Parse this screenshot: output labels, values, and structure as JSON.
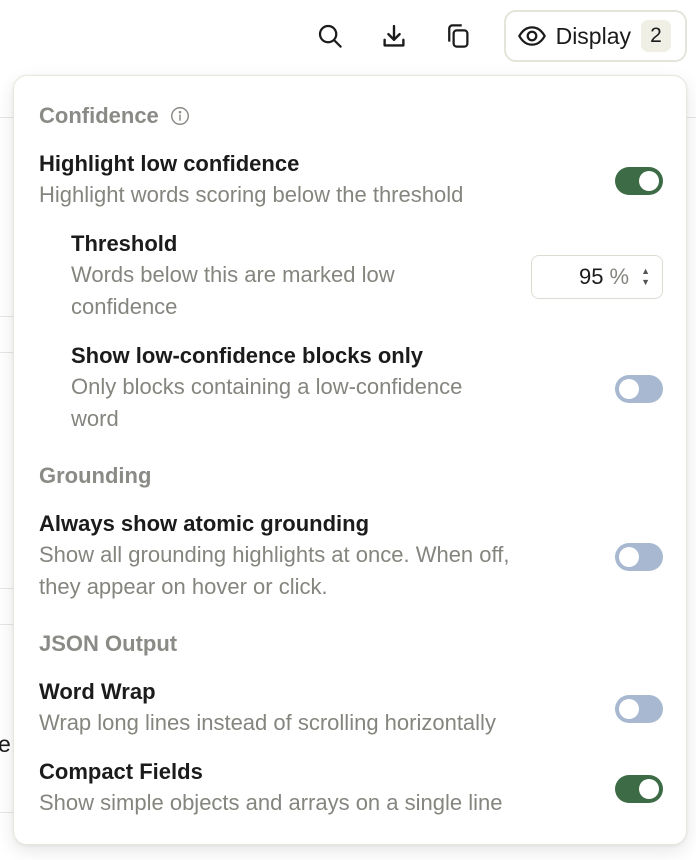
{
  "toolbar": {
    "icons": [
      "search-icon",
      "download-icon",
      "copy-icon",
      "eye-icon"
    ],
    "display_label": "Display",
    "display_count": "2"
  },
  "background": {
    "fragment_text": "e"
  },
  "panel": {
    "confidence": {
      "heading": "Confidence",
      "highlight": {
        "title": "Highlight low confidence",
        "desc": "Highlight words scoring below the threshold",
        "enabled": true
      },
      "threshold": {
        "title": "Threshold",
        "desc_line1": "Words below this are marked low",
        "desc_line2": "confidence",
        "value": "95",
        "unit": "%"
      },
      "blocks_only": {
        "title": "Show low-confidence blocks only",
        "desc_line1": "Only blocks containing a low-confidence",
        "desc_line2": "word",
        "enabled": false
      }
    },
    "grounding": {
      "heading": "Grounding",
      "atomic": {
        "title": "Always show atomic grounding",
        "desc_line1": "Show all grounding highlights at once. When off,",
        "desc_line2": "they appear on hover or click.",
        "enabled": false
      }
    },
    "json_output": {
      "heading": "JSON Output",
      "word_wrap": {
        "title": "Word Wrap",
        "desc": "Wrap long lines instead of scrolling horizontally",
        "enabled": false
      },
      "compact": {
        "title": "Compact Fields",
        "desc": "Show simple objects and arrays on a single line",
        "enabled": true
      }
    }
  },
  "colors": {
    "toggle_on": "#3d6b45",
    "toggle_off": "#a7b8d0",
    "section_heading": "#8a8a86",
    "description": "#85857f"
  }
}
